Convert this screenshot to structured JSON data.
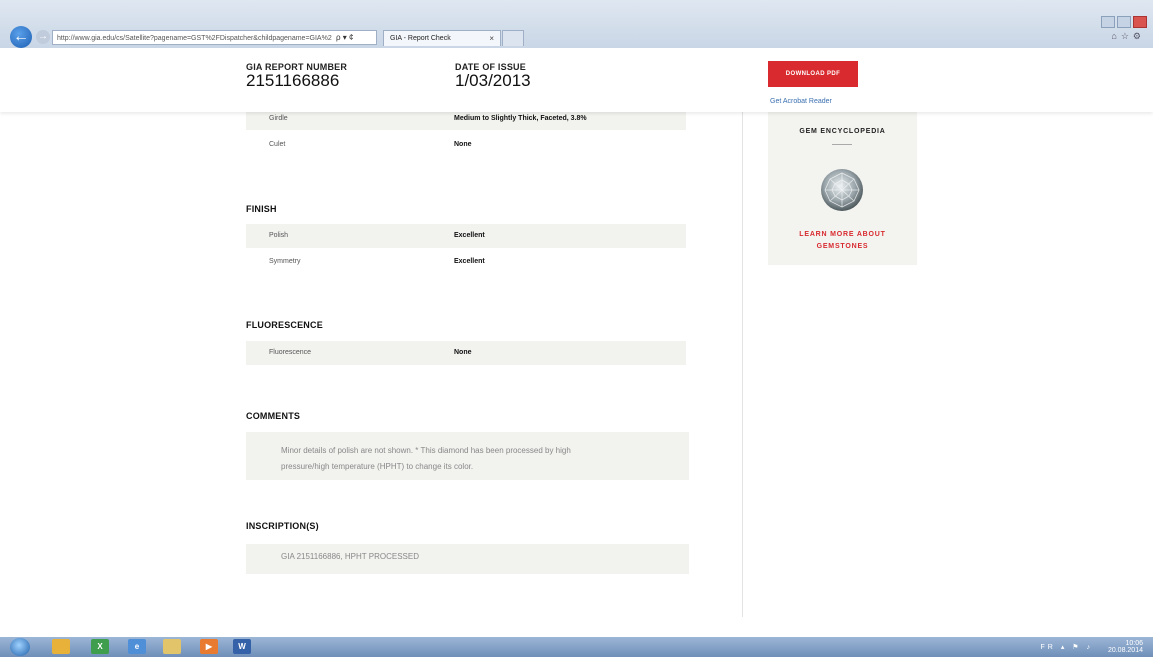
{
  "browser": {
    "address": "http://www.gia.edu/cs/Satellite?pagename=GST%2FDispatcher&childpagename=GIA%2",
    "address_tools": "ρ ▾ ¢",
    "tab_title": "GIA - Report Check",
    "tab_close": "×"
  },
  "header": {
    "report_number_label": "GIA REPORT NUMBER",
    "report_number": "2151166886",
    "date_label": "DATE OF ISSUE",
    "date": "1/03/2013",
    "download_label": "DOWNLOAD PDF",
    "acrobat_link": "Get Acrobat Reader"
  },
  "proportions_rows": [
    {
      "label": "Girdle",
      "value": "Medium to Slightly Thick, Faceted, 3.8%"
    },
    {
      "label": "Culet",
      "value": "None"
    }
  ],
  "finish": {
    "title": "FINISH",
    "rows": [
      {
        "label": "Polish",
        "value": "Excellent"
      },
      {
        "label": "Symmetry",
        "value": "Excellent"
      }
    ]
  },
  "fluorescence": {
    "title": "FLUORESCENCE",
    "rows": [
      {
        "label": "Fluorescence",
        "value": "None"
      }
    ]
  },
  "comments": {
    "title": "COMMENTS",
    "line1": "Minor details of polish are not shown. * This diamond has been processed by high",
    "line2": "pressure/high temperature (HPHT) to change its color."
  },
  "inscriptions": {
    "title": "INSCRIPTION(S)",
    "text": "GIA 2151166886, HPHT PROCESSED"
  },
  "sidebar": {
    "title": "GEM ENCYCLOPEDIA",
    "link_line1": "LEARN MORE ABOUT",
    "link_line2": "GEMSTONES"
  },
  "taskbar": {
    "tray_lang": "FR",
    "clock_time": "10:06",
    "clock_date": "20.08.2014"
  },
  "colors": {
    "accent_red": "#d82a2f",
    "panel_bg": "#f2f2ef",
    "link_blue": "#3a6fb0"
  }
}
